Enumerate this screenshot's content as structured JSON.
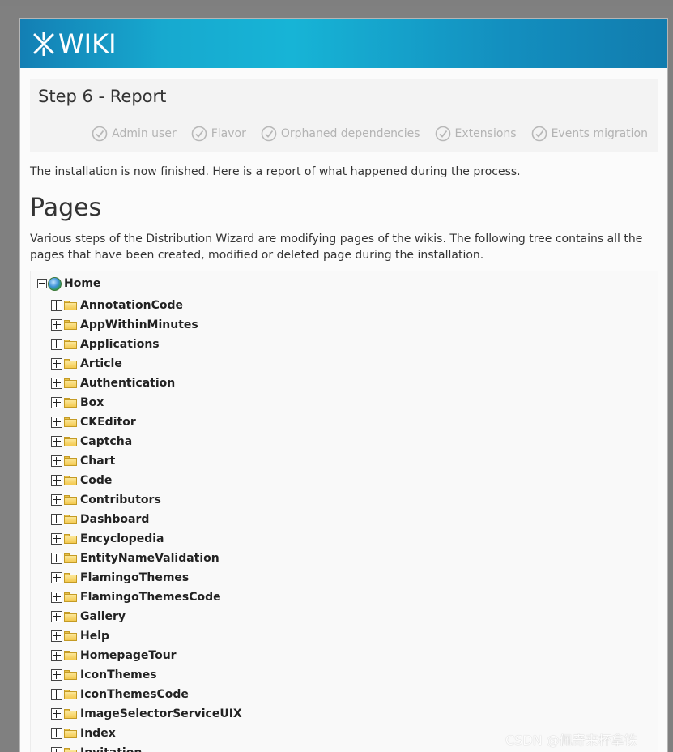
{
  "brand": {
    "logo_text": "WIKI",
    "header_colors": [
      "#137fb4",
      "#17b4d6",
      "#117cae"
    ]
  },
  "step": {
    "title": "Step 6 - Report",
    "completed_steps": [
      {
        "label": "Admin user"
      },
      {
        "label": "Flavor"
      },
      {
        "label": "Orphaned dependencies"
      },
      {
        "label": "Extensions"
      },
      {
        "label": "Events migration"
      }
    ]
  },
  "content": {
    "intro": "The installation is now finished. Here is a report of what happened during the process.",
    "pages_heading": "Pages",
    "pages_description": "Various steps of the Distribution Wizard are modifying pages of the wikis. The following tree contains all the pages that have been created, modified or deleted page during the installation."
  },
  "tree": {
    "root": {
      "label": "Home",
      "icon": "globe-icon",
      "state": "expanded"
    },
    "children": [
      {
        "label": "AnnotationCode"
      },
      {
        "label": "AppWithinMinutes"
      },
      {
        "label": "Applications"
      },
      {
        "label": "Article"
      },
      {
        "label": "Authentication"
      },
      {
        "label": "Box"
      },
      {
        "label": "CKEditor"
      },
      {
        "label": "Captcha"
      },
      {
        "label": "Chart"
      },
      {
        "label": "Code"
      },
      {
        "label": "Contributors"
      },
      {
        "label": "Dashboard"
      },
      {
        "label": "Encyclopedia"
      },
      {
        "label": "EntityNameValidation"
      },
      {
        "label": "FlamingoThemes"
      },
      {
        "label": "FlamingoThemesCode"
      },
      {
        "label": "Gallery"
      },
      {
        "label": "Help"
      },
      {
        "label": "HomepageTour"
      },
      {
        "label": "IconThemes"
      },
      {
        "label": "IconThemesCode"
      },
      {
        "label": "ImageSelectorServiceUIX"
      },
      {
        "label": "Index"
      },
      {
        "label": "Invitation"
      }
    ]
  },
  "watermark": "CSDN @佩奇来杯拿铁"
}
